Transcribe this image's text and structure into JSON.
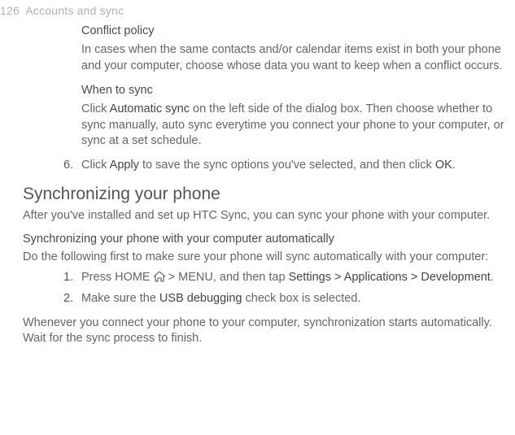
{
  "header": {
    "page_number": "126",
    "section": "Accounts and sync"
  },
  "blocks": {
    "conflict_title": "Conflict policy",
    "conflict_body": "In cases when the same contacts and/or calendar items exist in both your phone and your computer, choose whose data you want to keep when a conflict occurs.",
    "whensync_title": "When to sync",
    "whensync_prefix": "Click ",
    "whensync_bold": "Automatic sync",
    "whensync_rest": " on the left side of the dialog box. Then choose whether to sync manually, auto sync everytime you connect your phone to your computer, or sync at a set schedule."
  },
  "step6": {
    "num": "6.",
    "p1_prefix": "Click ",
    "p1_bold1": "Apply",
    "p1_mid": " to save the sync options you've selected, and then click ",
    "p1_bold2": "OK",
    "p1_suffix": "."
  },
  "section2": {
    "title": "Synchronizing your phone",
    "lead": "After you've installed and set up HTC Sync, you can sync your phone with your computer.",
    "sub_title": "Synchronizing your phone with your computer automatically",
    "sub_lead": "Do the following first to make sure your phone will sync automatically with your computer:"
  },
  "step1": {
    "num": "1.",
    "prefix": "Press HOME ",
    "mid": " > MENU, and then tap ",
    "bold": "Settings > Applications > Development",
    "suffix": "."
  },
  "step2": {
    "num": "2.",
    "prefix": "Make sure the ",
    "bold": "USB debugging",
    "suffix": " check box is selected."
  },
  "tail": "Whenever you connect your phone to your computer, synchronization starts automatically. Wait for the sync process to finish."
}
